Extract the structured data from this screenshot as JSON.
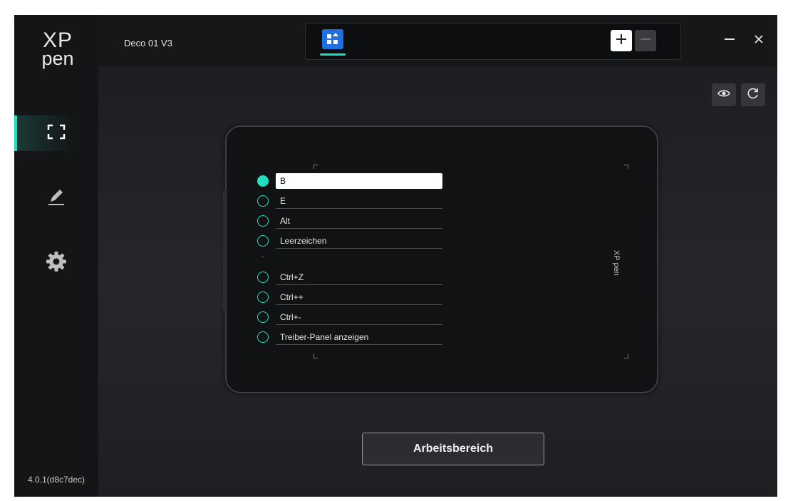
{
  "app": {
    "logo_top": "XP",
    "logo_bottom": "pen",
    "version": "4.0.1(d8c7dec)",
    "device_name": "Deco 01 V3"
  },
  "sidebar": {
    "items": [
      {
        "name": "work-area",
        "icon": "fullscreen-frame-icon",
        "active": true
      },
      {
        "name": "pen",
        "icon": "pen-icon",
        "active": false
      },
      {
        "name": "settings",
        "icon": "gear-icon",
        "active": false
      }
    ]
  },
  "tabs": {
    "app_icon": "all-apps-grid-icon",
    "add_icon": "plus-icon",
    "remove_icon": "minus-icon"
  },
  "window": {
    "minimize_icon": "minimize-icon",
    "close_icon": "close-icon"
  },
  "toolbar": {
    "preview_icon": "eye-icon",
    "refresh_icon": "refresh-icon"
  },
  "tablet": {
    "logo": "XP pen",
    "keys_group1": [
      {
        "label": "B",
        "selected": true
      },
      {
        "label": "E",
        "selected": false
      },
      {
        "label": "Alt",
        "selected": false
      },
      {
        "label": "Leerzeichen",
        "selected": false
      }
    ],
    "separator": "-",
    "keys_group2": [
      {
        "label": "Ctrl+Z",
        "selected": false
      },
      {
        "label": "Ctrl++",
        "selected": false
      },
      {
        "label": "Ctrl+-",
        "selected": false
      },
      {
        "label": "Treiber-Panel anzeigen",
        "selected": false
      }
    ]
  },
  "actions": {
    "work_area_button": "Arbeitsbereich"
  },
  "colors": {
    "accent": "#1fe0be",
    "tab_icon": "#1f6fe0",
    "background": "#1d1f22"
  }
}
